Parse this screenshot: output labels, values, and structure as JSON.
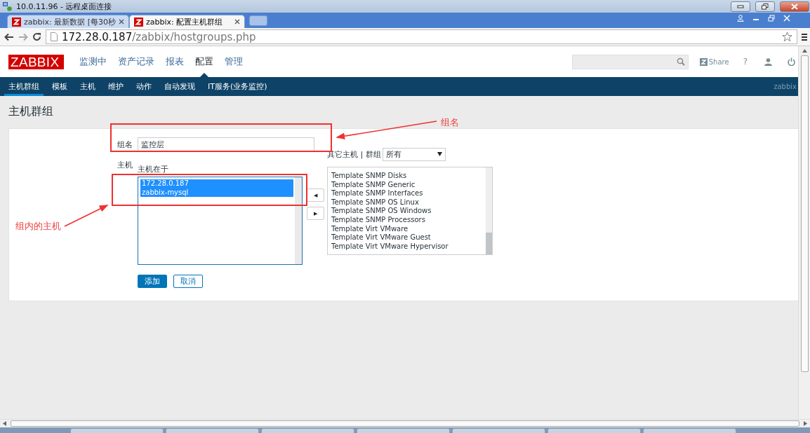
{
  "rdp_window": {
    "title": "10.0.11.96 - 远程桌面连接"
  },
  "browser": {
    "tabs": [
      {
        "label": "zabbix: 最新数据 [每30秒",
        "selected": false
      },
      {
        "label": "zabbix: 配置主机群组",
        "selected": true
      }
    ],
    "url_host": "172.28.0.187",
    "url_path": "/zabbix/hostgroups.php"
  },
  "header": {
    "logo": "ZABBIX",
    "menu": [
      {
        "label": "监测中",
        "selected": false
      },
      {
        "label": "资产记录",
        "selected": false
      },
      {
        "label": "报表",
        "selected": false
      },
      {
        "label": "配置",
        "selected": true
      },
      {
        "label": "管理",
        "selected": false
      }
    ],
    "share": "Share",
    "help": "?"
  },
  "subnav": {
    "items": [
      {
        "label": "主机群组",
        "selected": true
      },
      {
        "label": "模板",
        "selected": false
      },
      {
        "label": "主机",
        "selected": false
      },
      {
        "label": "维护",
        "selected": false
      },
      {
        "label": "动作",
        "selected": false
      },
      {
        "label": "自动发现",
        "selected": false
      },
      {
        "label": "IT服务(业务监控)",
        "selected": false
      }
    ],
    "user": "zabbix"
  },
  "page_title": "主机群组",
  "form": {
    "group_name_label": "组名",
    "group_name_value": "监控层",
    "hosts_label": "主机",
    "in_group_label": "主机在于",
    "in_group_hosts": [
      {
        "label": "172.28.0.187",
        "selected": true
      },
      {
        "label": "zabbix-mysql",
        "selected": true
      }
    ],
    "other_label": "其它主机 | 群组",
    "other_filter": "所有",
    "other_hosts": [
      {
        "label": "Template SNMP Disks",
        "selected": false
      },
      {
        "label": "Template SNMP Generic",
        "selected": false
      },
      {
        "label": "Template SNMP Interfaces",
        "selected": false
      },
      {
        "label": "Template SNMP OS Linux",
        "selected": false
      },
      {
        "label": "Template SNMP OS Windows",
        "selected": false
      },
      {
        "label": "Template SNMP Processors",
        "selected": false
      },
      {
        "label": "Template Virt VMware",
        "selected": false
      },
      {
        "label": "Template Virt VMware Guest",
        "selected": false
      },
      {
        "label": "Template Virt VMware Hypervisor",
        "selected": false
      }
    ],
    "move_left": "◀",
    "move_right": "▶",
    "buttons": [
      {
        "label": "添加",
        "kind": "primary"
      },
      {
        "label": "取消",
        "kind": "secondary"
      }
    ]
  },
  "annotations": [
    {
      "text": "组名"
    },
    {
      "text": "组内的主机"
    }
  ]
}
